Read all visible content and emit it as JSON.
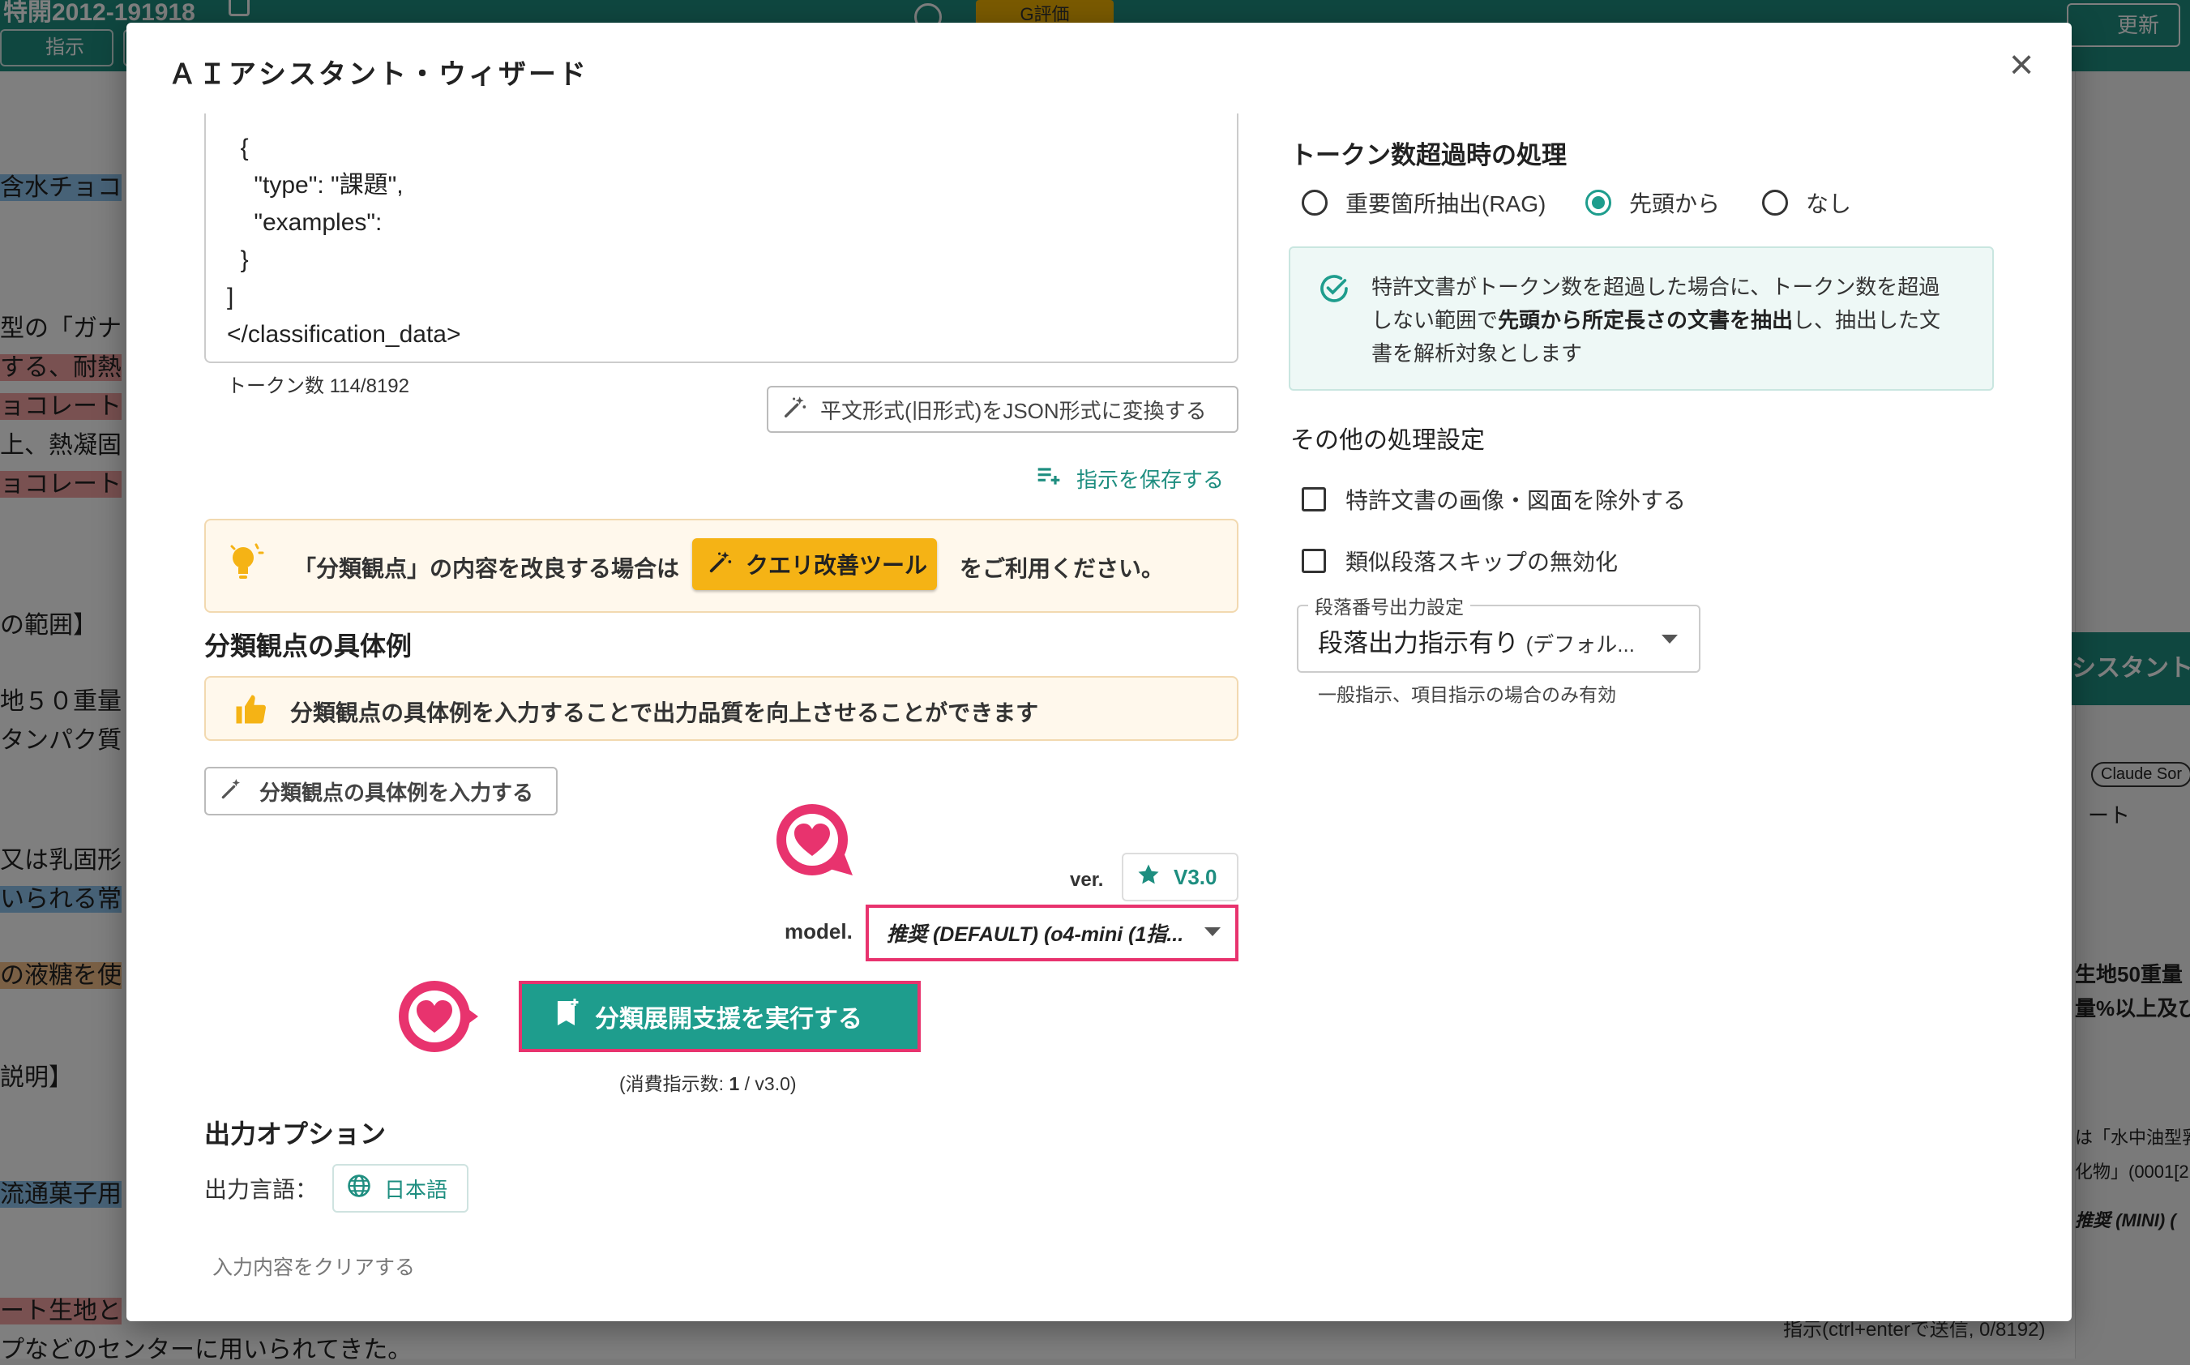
{
  "background": {
    "title": "特開2012-191918",
    "badge": "G評価",
    "instruct_btn": "指示",
    "update_btn": "更新",
    "side_lines": [
      "含水チョコ",
      "型の「ガナ",
      "する、耐熱",
      "ョコレート",
      "上、熱凝固",
      "ョコレート",
      "の範囲】",
      "地５０重量",
      "タンパク質",
      "又は乳固形",
      "いられる常",
      "の液糖を使",
      "説明】",
      "流通菓子用",
      "ート生地と",
      "プなどのセンターに用いられてきた。"
    ],
    "right_panel": {
      "assistant": "シスタント",
      "claude_chip": "Claude Sor",
      "rt": "ート",
      "text1": "生地50重量",
      "text2": "量%以上及び",
      "text3": "は「水中油型乳",
      "text4": "化物」(0001[2",
      "model": "推奨 (MINI) (",
      "footer": "指示(ctrl+enterで送信, 0/8192)"
    }
  },
  "modal": {
    "title": "ＡＩアシスタント・ウィザード",
    "close_icon": "×",
    "editor_lines": [
      "  {",
      "    \"type\": \"課題\",",
      "    \"examples\":",
      "  }",
      "]",
      "</classification_data>"
    ],
    "token_count": "トークン数 114/8192",
    "convert_button": "平文形式(旧形式)をJSON形式に変換する",
    "save_instruction": "指示を保存する",
    "tip": {
      "before": "「分類観点」の内容を改良する場合は",
      "button": "クエリ改善ツール",
      "after": "をご利用ください。"
    },
    "examples_heading": "分類観点の具体例",
    "examples_tip": "分類観点の具体例を入力することで出力品質を向上させることができます",
    "examples_button": "分類観点の具体例を入力する",
    "version_label": "ver.",
    "version_value": "V3.0",
    "model_label": "model.",
    "model_value": "推奨 (DEFAULT) (o4-mini (1指...",
    "run_button": "分類展開支援を実行する",
    "consume": {
      "prefix": "(消費指示数: ",
      "count": "1",
      "suffix": "  / v3.0)"
    },
    "output_heading": "出力オプション",
    "language_label": "出力言語：",
    "language_value": "日本語",
    "clear_link": "入力内容をクリアする",
    "token_overflow": {
      "heading": "トークン数超過時の処理",
      "options": [
        {
          "label": "重要箇所抽出(RAG)",
          "selected": false
        },
        {
          "label": "先頭から",
          "selected": true
        },
        {
          "label": "なし",
          "selected": false
        }
      ],
      "info_parts": [
        "特許文書がトークン数を超過した場合に、トークン数を超過しない範囲で",
        "先頭から所定長さの文書を抽出",
        "し、抽出した文書を解析対象とします"
      ]
    },
    "other_settings": {
      "heading": "その他の処理設定",
      "checkboxes": [
        {
          "label": "特許文書の画像・図面を除外する",
          "checked": false
        },
        {
          "label": "類似段落スキップの無効化",
          "checked": false
        }
      ],
      "paragraph_label": "段落番号出力設定",
      "paragraph_value": "段落出力指示有り",
      "paragraph_value_small": "(デフォル...",
      "paragraph_help": "一般指示、項目指示の場合のみ有効"
    },
    "colors": {
      "accent": "#1e9d8d",
      "highlight": "#e8336e",
      "warning": "#f5b315"
    }
  }
}
